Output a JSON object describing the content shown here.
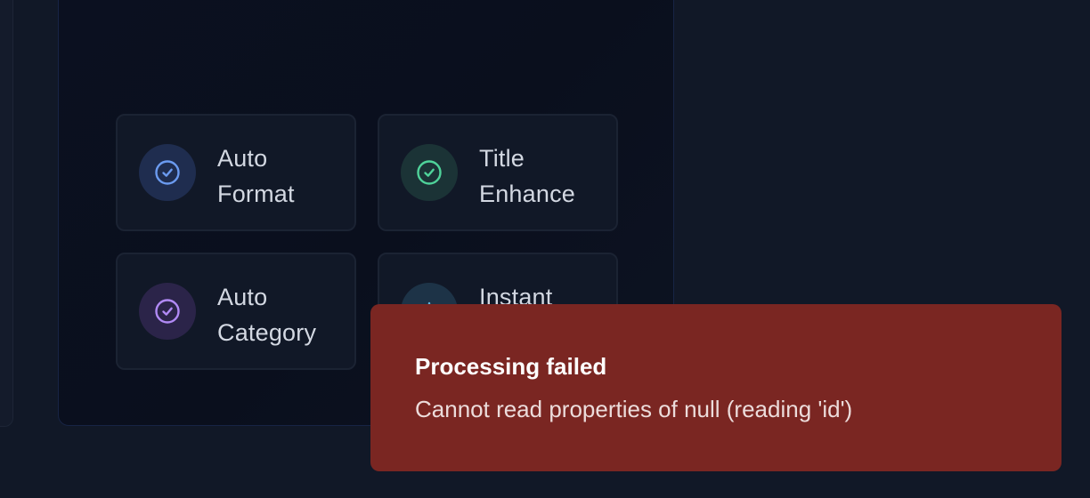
{
  "features": [
    {
      "line1": "Auto",
      "line2": "Format",
      "icon": "check-circle-icon",
      "color": "#6b9bf0"
    },
    {
      "line1": "Title",
      "line2": "Enhance",
      "icon": "check-circle-icon",
      "color": "#4fd39a"
    },
    {
      "line1": "Auto",
      "line2": "Category",
      "icon": "check-circle-icon",
      "color": "#b18af5"
    },
    {
      "line1": "Instant",
      "line2": "",
      "icon": "lightning-icon",
      "color": "#5fb3d9"
    }
  ],
  "toast": {
    "title": "Processing failed",
    "message": "Cannot read properties of null (reading 'id')"
  }
}
